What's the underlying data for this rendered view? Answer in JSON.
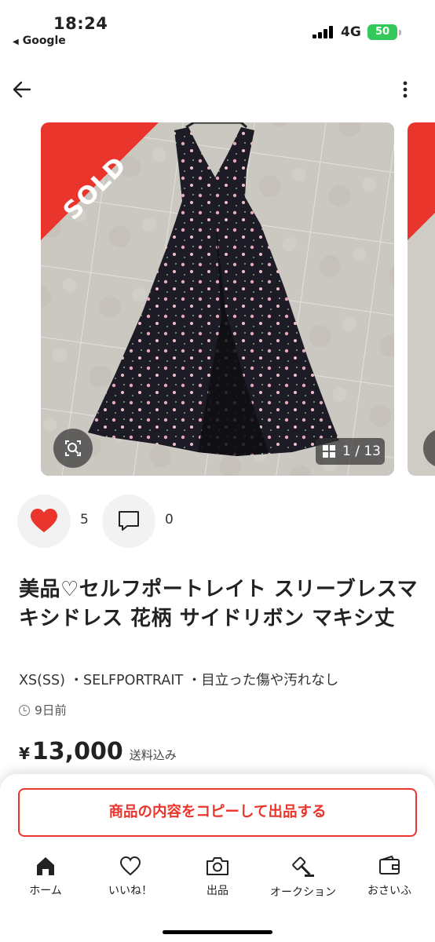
{
  "status_bar": {
    "time": "18:24",
    "back_app": "Google",
    "network": "4G",
    "battery": "50"
  },
  "header": {
    "back_icon": "arrow-left-icon",
    "more_icon": "more-vertical-icon"
  },
  "gallery": {
    "badge": "SOLD",
    "counter": "1 / 13",
    "current_index": 1,
    "total": 13
  },
  "actions": {
    "like_count": "5",
    "comment_count": "0",
    "like_color": "#ea352d"
  },
  "item": {
    "title": "美品♡セルフポートレイト スリーブレスマキシドレス 花柄 サイドリボン マキシ丈",
    "meta": "XS(SS) ・SELFPORTRAIT ・目立った傷や汚れなし",
    "posted": "9日前",
    "price_symbol": "¥",
    "price": "13,000",
    "shipping": "送料込み"
  },
  "cta": {
    "copy_label": "商品の内容をコピーして出品する"
  },
  "tabbar": {
    "items": [
      {
        "label": "ホーム",
        "icon": "home-icon"
      },
      {
        "label": "いいね！",
        "icon": "heart-icon"
      },
      {
        "label": "出品",
        "icon": "camera-icon"
      },
      {
        "label": "オークション",
        "icon": "gavel-icon"
      },
      {
        "label": "おさいふ",
        "icon": "wallet-icon"
      }
    ]
  },
  "colors": {
    "accent": "#ea352d",
    "battery": "#34c759"
  }
}
